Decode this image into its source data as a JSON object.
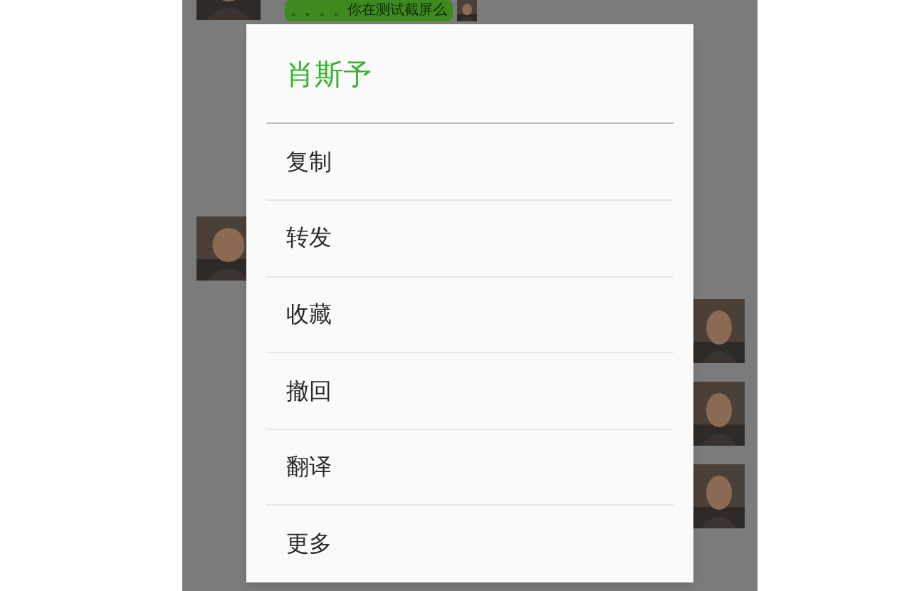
{
  "chat_background": {
    "bubble_text": "。。。。你在测试截屏么"
  },
  "dialog": {
    "title": "肖斯予",
    "items": [
      {
        "label": "复制"
      },
      {
        "label": "转发"
      },
      {
        "label": "收藏"
      },
      {
        "label": "撤回"
      },
      {
        "label": "翻译"
      },
      {
        "label": "更多"
      }
    ]
  }
}
